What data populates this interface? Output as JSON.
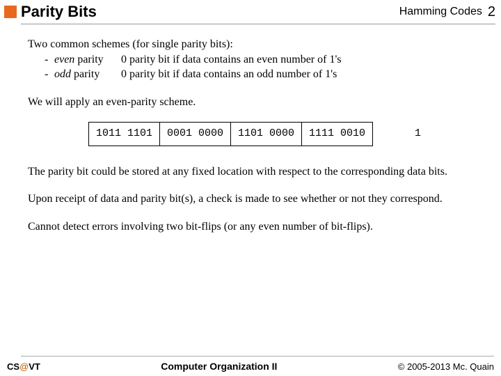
{
  "header": {
    "title": "Parity Bits",
    "topic": "Hamming Codes",
    "page": "2"
  },
  "body": {
    "intro": "Two common schemes (for single parity bits):",
    "schemes": [
      {
        "dash": "-",
        "name_italic": "even ",
        "name_plain": "parity",
        "desc": "0 parity bit if data contains an even number of 1's"
      },
      {
        "dash": "-",
        "name_italic": "odd ",
        "name_plain": "parity",
        "desc": "0 parity bit if data contains an odd number of 1's"
      }
    ],
    "apply": "We will apply an even-parity scheme.",
    "cells": [
      "1011 1101",
      "0001 0000",
      "1101 0000",
      "1111 0010"
    ],
    "extra": "1",
    "p_storage": "The parity bit could be stored at any fixed location with respect to the corresponding data bits.",
    "p_receipt": "Upon receipt of data and parity bit(s), a check is made to see whether or not they correspond.",
    "p_limit": "Cannot detect errors involving two bit-flips (or any even number of bit-flips)."
  },
  "footer": {
    "left_cs": "CS",
    "left_at": "@",
    "left_vt": "VT",
    "center": "Computer Organization II",
    "right": "© 2005-2013 Mc. Quain"
  }
}
